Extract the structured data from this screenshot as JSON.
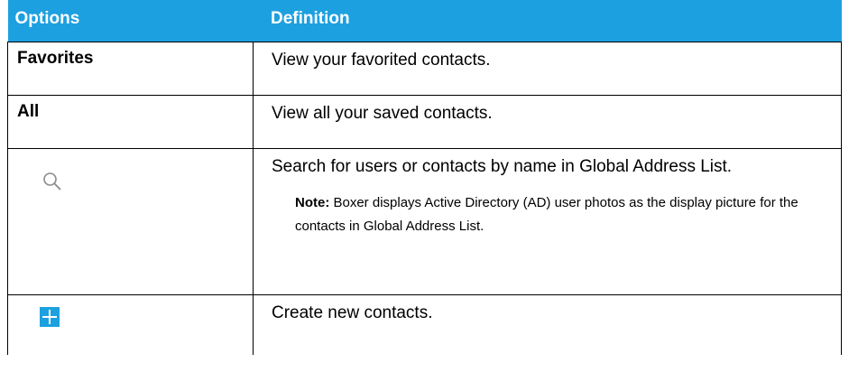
{
  "table": {
    "headers": {
      "options": "Options",
      "definition": "Definition"
    },
    "rows": [
      {
        "option": "Favorites",
        "definition": "View your favorited contacts."
      },
      {
        "option": "All",
        "definition": "View all your saved contacts."
      },
      {
        "option_icon": "search-icon",
        "definition": "Search for users or contacts by name in Global Address List.",
        "note_label": "Note:",
        "note_text": " Boxer displays Active Directory (AD) user photos as the display picture for the contacts in Global Address List."
      },
      {
        "option_icon": "add-contact-icon",
        "definition": "Create new contacts."
      }
    ]
  },
  "colors": {
    "header_background": "#1DA0E0",
    "header_text": "#FFFFFF",
    "add_icon": "#1DA0E0",
    "search_icon": "#8A8A8A"
  }
}
